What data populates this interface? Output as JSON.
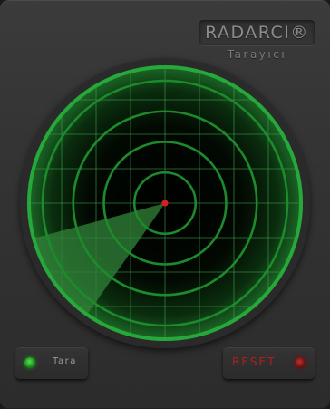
{
  "header": {
    "brand": "RADARCI®",
    "subtitle": "Tarayıcı"
  },
  "radar": {
    "rings": 4,
    "sweep_angle_deg": 215,
    "sweep_width_deg": 40,
    "target": {
      "distance": 0.0,
      "color": "#d81e1e"
    },
    "colors": {
      "rim": "#27a83a",
      "ring": "#1d8a2c",
      "grid": "#3fa14d",
      "background": "#000000",
      "sweep": "#2f7f37"
    }
  },
  "controls": {
    "scan_label": "Tara",
    "scan_led": "green",
    "reset_label": "RESET",
    "reset_led": "red"
  }
}
